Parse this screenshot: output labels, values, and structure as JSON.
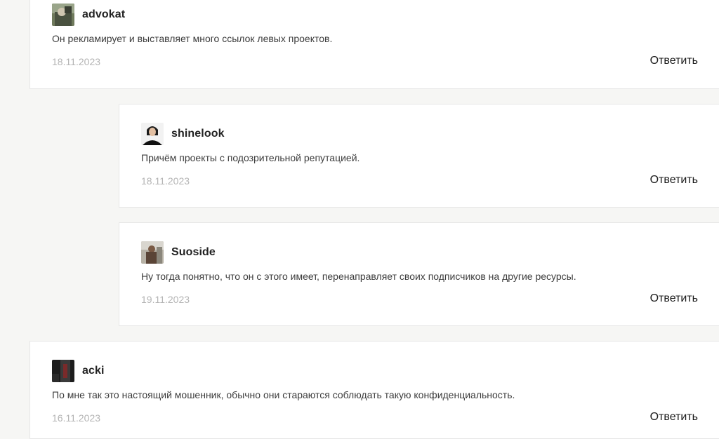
{
  "comments": [
    {
      "author": "advokat",
      "text": "Он рекламирует и выставляет много ссылок левых проектов.",
      "date": "18.11.2023",
      "reply_label": "Ответить",
      "avatar": "user-photo-icon"
    },
    {
      "author": "shinelook",
      "text": "Причём проекты с подозрительной репутацией.",
      "date": "18.11.2023",
      "reply_label": "Ответить",
      "avatar": "user-photo-icon"
    },
    {
      "author": "Suoside",
      "text": "Ну тогда понятно, что он с этого имеет, перенаправляет своих подписчиков на другие ресурсы.",
      "date": "19.11.2023",
      "reply_label": "Ответить",
      "avatar": "user-photo-icon"
    },
    {
      "author": "acki",
      "text": "По мне так это настоящий мошенник, обычно они стараются соблюдать такую конфиденциальность.",
      "date": "16.11.2023",
      "reply_label": "Ответить",
      "avatar": "user-photo-icon"
    }
  ],
  "colors": {
    "background": "#f6f6f4",
    "card": "#ffffff",
    "border": "#e6e6e6",
    "date": "#b4b4b4",
    "text": "#3c3c3c"
  }
}
